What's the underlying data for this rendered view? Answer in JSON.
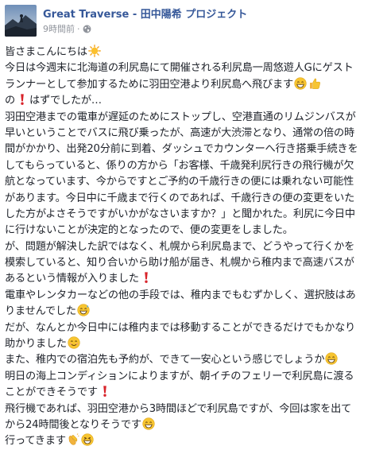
{
  "post": {
    "page_name": "Great Traverse - 田中陽希 プロジェクト",
    "timestamp": "9時間前",
    "separator": "·",
    "privacy_icon": "globe-icon",
    "lines": [
      {
        "text": "皆さまこんにちは",
        "emoji": [
          "sun"
        ]
      },
      {
        "text": "今日は今週末に北海道の利尻島にて開催される利尻島一周悠遊人Gにゲスト",
        "emoji": []
      },
      {
        "text": "ランナーとして参加するために羽田空港より利尻島へ飛びます",
        "emoji": [
          "grin",
          "thumbs-up"
        ]
      },
      {
        "text": "の",
        "emoji": [
          "exclamation"
        ],
        "text_after": "はずでしたが…"
      },
      {
        "text": "羽田空港までの電車が遅延のためにストップし、空港直通のリムジンバスが",
        "emoji": []
      },
      {
        "text": "早いということでバスに飛び乗ったが、高速が大渋滞となり、通常の倍の時",
        "emoji": []
      },
      {
        "text": "間がかかり、出発20分前に到着、ダッシュでカウンターへ行き搭乗手続きを",
        "emoji": []
      },
      {
        "text": "してもらっていると、係りの方から「お客様、千歳発利尻行きの飛行機が欠",
        "emoji": []
      },
      {
        "text": "航となっています、今からですとご予約の千歳行きの便には乗れない可能性",
        "emoji": []
      },
      {
        "text": "があります。今日中に千歳まで行くのであれば、千歳行きの便の変更をいた",
        "emoji": []
      },
      {
        "text": "した方がよさそうですがいかがなさいますか？」と聞かれた。利尻に今日中",
        "emoji": []
      },
      {
        "text": "に行けないことが決定的となったので、便の変更をしました。",
        "emoji": []
      },
      {
        "text": "が、問題が解決した訳ではなく、札幌から利尻島まで、どうやって行くかを",
        "emoji": []
      },
      {
        "text": "模索していると、知り合いから助け船が届き、札幌から稚内まで高速バスが",
        "emoji": []
      },
      {
        "text": "あるという情報が入りました",
        "emoji": [
          "exclamation"
        ]
      },
      {
        "text": "電車やレンタカーなどの他の手段では、稚内までもむずかしく、選択肢はあ",
        "emoji": []
      },
      {
        "text": "りませんでした",
        "emoji": [
          "sweat-smile"
        ]
      },
      {
        "text": "だが、なんとか今日中には稚内までは移動することができるだけでもかなり",
        "emoji": []
      },
      {
        "text": "助かりました",
        "emoji": [
          "smile"
        ]
      },
      {
        "text": "また、稚内での宿泊先も予約が、できて一安心という感じでしょうか",
        "emoji": [
          "grin"
        ]
      },
      {
        "text": "明日の海上コンディションによりますが、朝イチのフェリーで利尻島に渡る",
        "emoji": []
      },
      {
        "text": "ことができそうです",
        "emoji": [
          "exclamation"
        ]
      },
      {
        "text": "飛行機であれば、羽田空港から3時間ほどで利尻島ですが、今回は家を出て",
        "emoji": []
      },
      {
        "text": "から24時間後となりそうです",
        "emoji": [
          "grin"
        ]
      },
      {
        "text": "行ってきます",
        "emoji": [
          "clap",
          "laugh"
        ]
      }
    ]
  },
  "colors": {
    "page_name": "#365899",
    "meta": "#90949c",
    "text": "#1d2129",
    "exclamation": "#d8232a",
    "emoji_face": "#f7c531"
  }
}
